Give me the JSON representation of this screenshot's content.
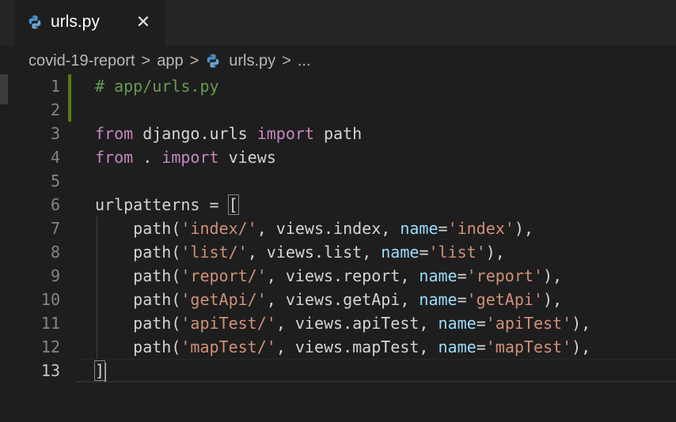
{
  "tab": {
    "label": "urls.py",
    "close_glyph": "✕",
    "icon": "python-file-icon"
  },
  "breadcrumb": {
    "items": [
      "covid-19-report",
      "app",
      "urls.py",
      "..."
    ],
    "separator": ">"
  },
  "editor": {
    "language": "python",
    "active_line": 13,
    "line_numbers": [
      "1",
      "2",
      "3",
      "4",
      "5",
      "6",
      "7",
      "8",
      "9",
      "10",
      "11",
      "12",
      "13"
    ],
    "lines": {
      "l1": {
        "comment": "# app/urls.py"
      },
      "l3": {
        "kw1": "from",
        "mod": " django.urls ",
        "kw2": "import",
        "rest": " path"
      },
      "l4": {
        "kw1": "from",
        "mod": " . ",
        "kw2": "import",
        "rest": " views"
      },
      "l6": {
        "text": "urlpatterns = ",
        "bracket": "["
      },
      "l13": {
        "bracket": "]"
      }
    },
    "routes": [
      {
        "func": "path(",
        "route": "'index/'",
        "view": ", views.index, ",
        "kw": "name",
        "eq": "=",
        "name": "'index'",
        "end": "),"
      },
      {
        "func": "path(",
        "route": "'list/'",
        "view": ", views.list, ",
        "kw": "name",
        "eq": "=",
        "name": "'list'",
        "end": "),"
      },
      {
        "func": "path(",
        "route": "'report/'",
        "view": ", views.report, ",
        "kw": "name",
        "eq": "=",
        "name": "'report'",
        "end": "),"
      },
      {
        "func": "path(",
        "route": "'getApi/'",
        "view": ", views.getApi, ",
        "kw": "name",
        "eq": "=",
        "name": "'getApi'",
        "end": "),"
      },
      {
        "func": "path(",
        "route": "'apiTest/'",
        "view": ", views.apiTest, ",
        "kw": "name",
        "eq": "=",
        "name": "'apiTest'",
        "end": "),"
      },
      {
        "func": "path(",
        "route": "'mapTest/'",
        "view": ", views.mapTest, ",
        "kw": "name",
        "eq": "=",
        "name": "'mapTest'",
        "end": "),"
      }
    ]
  },
  "colors": {
    "background": "#1e1e1e",
    "comment": "#6a9955",
    "keyword": "#c586c0",
    "string": "#ce9178",
    "parameter": "#9cdcfe",
    "modified_gutter": "#587c0c"
  }
}
